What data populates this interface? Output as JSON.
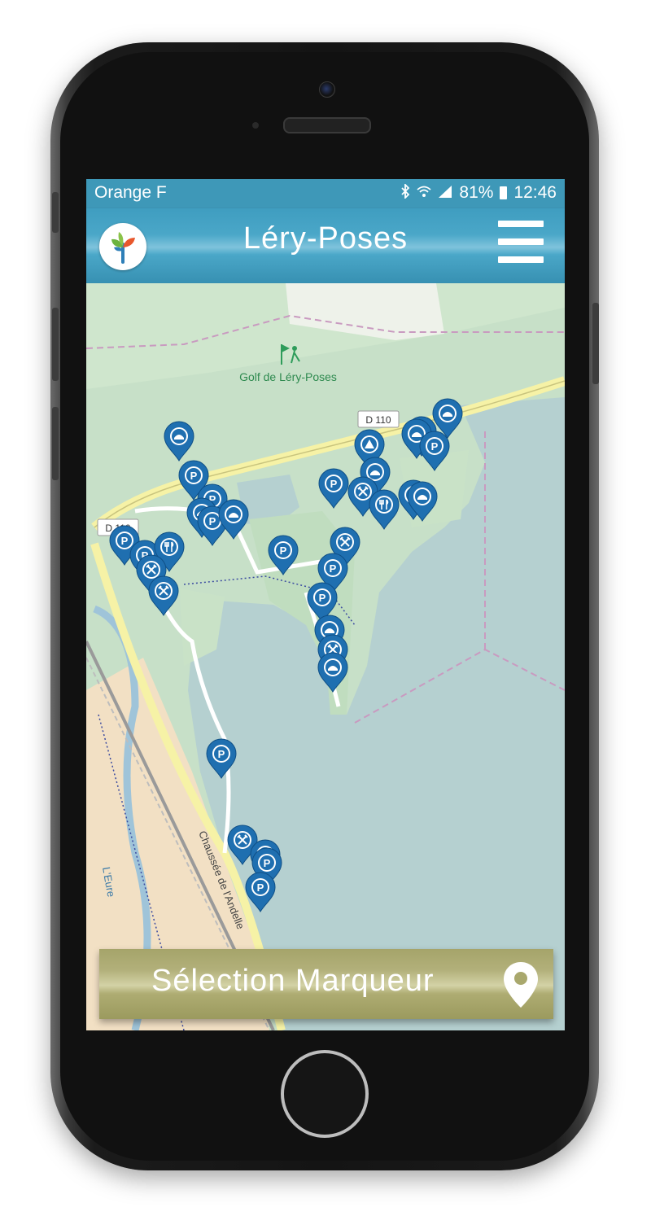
{
  "status_bar": {
    "carrier": "Orange F",
    "battery": "81%",
    "time": "12:46",
    "icons": [
      "bluetooth-icon",
      "wifi-icon",
      "signal-icon",
      "battery-icon"
    ]
  },
  "app_bar": {
    "title": "Léry-Poses",
    "logo": "tree-logo-icon",
    "menu": "hamburger-menu-icon"
  },
  "map": {
    "labels": {
      "golf": "Golf de Léry-Poses",
      "road_d110": "D 110",
      "road_d110_left": "D 110",
      "road_chaussee": "Chaussée de l'Andelle",
      "river": "L'Eure"
    },
    "marker_types": [
      "parking",
      "restaurant",
      "camping",
      "tools",
      "circle"
    ]
  },
  "bottom_button": {
    "label": "Sélection Marqueur",
    "icon": "map-pin-icon"
  },
  "colors": {
    "accent_blue": "#3e98b8",
    "marker_blue": "#1f6fb0",
    "olive": "#a5a46a",
    "water": "#b5d0d0",
    "land": "#c7e0c8"
  }
}
